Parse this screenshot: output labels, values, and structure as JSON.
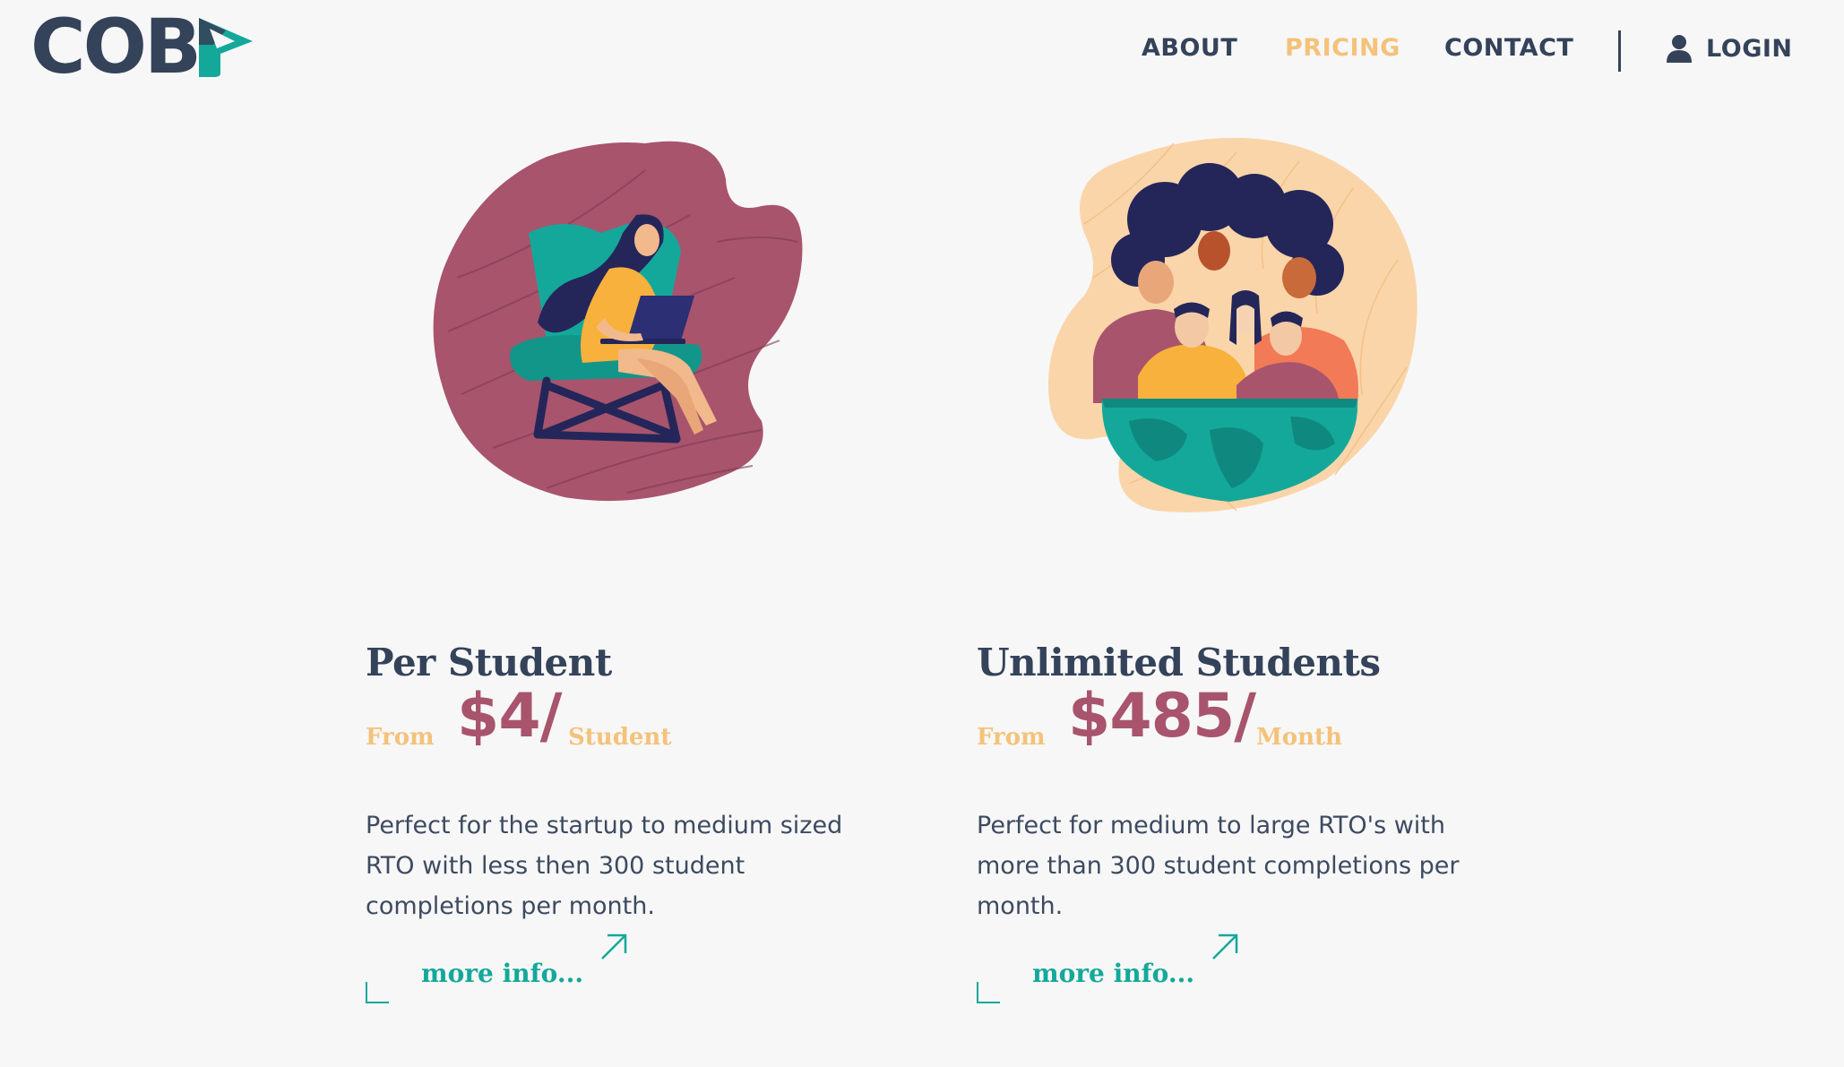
{
  "brand": {
    "logo_text": "COB",
    "logo_mark_icon": "play-triangle-icon"
  },
  "nav": {
    "items": [
      {
        "label": "ABOUT"
      },
      {
        "label": "PRICING",
        "active": true
      },
      {
        "label": "CONTACT"
      }
    ],
    "login_label": "LOGIN",
    "login_icon": "user-icon"
  },
  "colors": {
    "navy": "#34435a",
    "accent_gold": "#f4c27a",
    "price_maroon": "#a8546d",
    "teal": "#14a89a",
    "background": "#f7f7f7"
  },
  "plans": [
    {
      "title": "Per Student",
      "from_label": "From",
      "price": "$4/",
      "unit": "Student",
      "description": "Perfect for the startup to medium sized RTO with less then 300 student completions per month.",
      "more_label": "more info...",
      "illustration": "woman-with-laptop-in-chair-illustration"
    },
    {
      "title": "Unlimited Students",
      "from_label": "From",
      "price": "$485/",
      "unit": "Month",
      "description": "Perfect for medium to large RTO's with more than 300 student completions per month.",
      "more_label": "more info...",
      "illustration": "group-of-people-on-globe-illustration"
    }
  ]
}
